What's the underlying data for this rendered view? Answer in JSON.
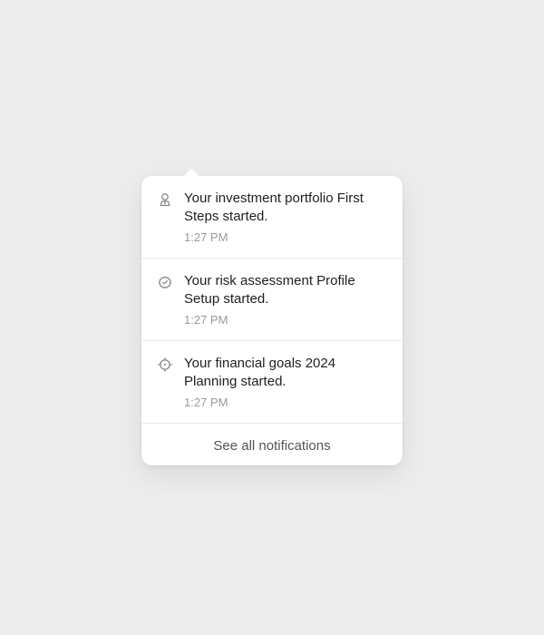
{
  "notifications": {
    "items": [
      {
        "icon": "user-badge-icon",
        "text": "Your investment portfolio First Steps started.",
        "time": "1:27 PM"
      },
      {
        "icon": "check-circle-icon",
        "text": "Your risk assessment Profile Setup started.",
        "time": "1:27 PM"
      },
      {
        "icon": "crosshair-icon",
        "text": "Your financial goals 2024 Planning started.",
        "time": "1:27 PM"
      }
    ],
    "footer_label": "See all notifications"
  }
}
